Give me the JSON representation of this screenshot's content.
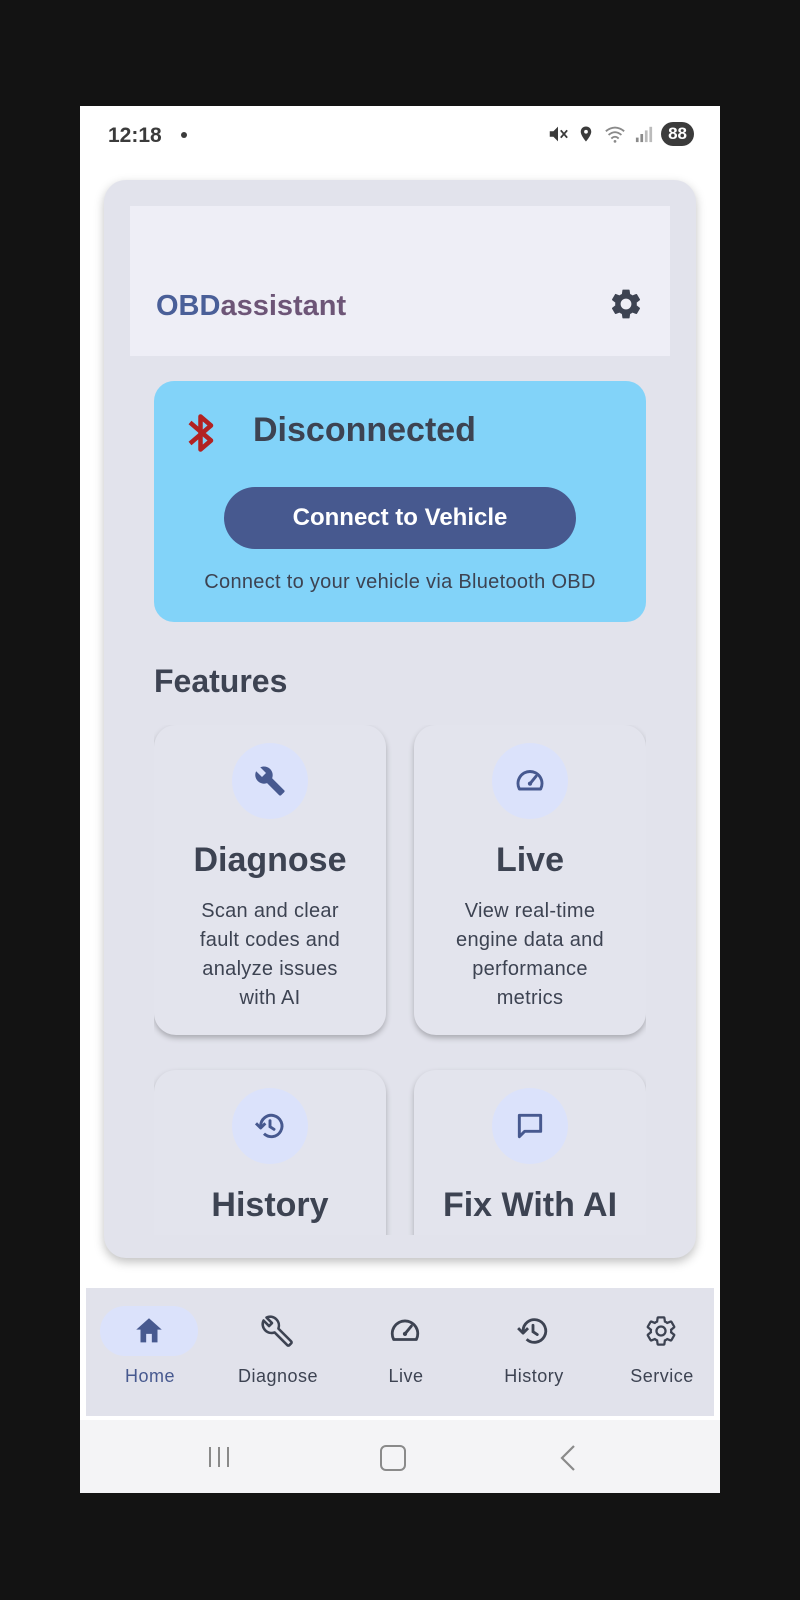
{
  "status_bar": {
    "time": "12:18",
    "battery": "88"
  },
  "app": {
    "brand_part1": "OBD",
    "brand_part2": "assistant"
  },
  "connection": {
    "status": "Disconnected",
    "button_label": "Connect to Vehicle",
    "subtitle": "Connect to your vehicle via Bluetooth OBD"
  },
  "features": {
    "title": "Features",
    "items": [
      {
        "title": "Diagnose",
        "desc": "Scan and clear fault codes and analyze issues with AI",
        "icon": "wrench-icon"
      },
      {
        "title": "Live",
        "desc": "View real-time engine data and performance metrics",
        "icon": "speedometer-icon"
      },
      {
        "title": "History",
        "icon": "history-icon"
      },
      {
        "title": "Fix With AI",
        "icon": "chat-icon"
      }
    ]
  },
  "bottom_nav": {
    "items": [
      {
        "label": "Home",
        "icon": "home-icon",
        "active": true
      },
      {
        "label": "Diagnose",
        "icon": "wrench-icon"
      },
      {
        "label": "Live",
        "icon": "speedometer-icon"
      },
      {
        "label": "History",
        "icon": "history-icon"
      },
      {
        "label": "Service",
        "icon": "gear-icon"
      }
    ]
  },
  "colors": {
    "accent": "#47598f",
    "connection_card": "#82d3f9",
    "bluetooth_disconnected": "#b22222",
    "icon_circle": "#dbe2fb"
  }
}
